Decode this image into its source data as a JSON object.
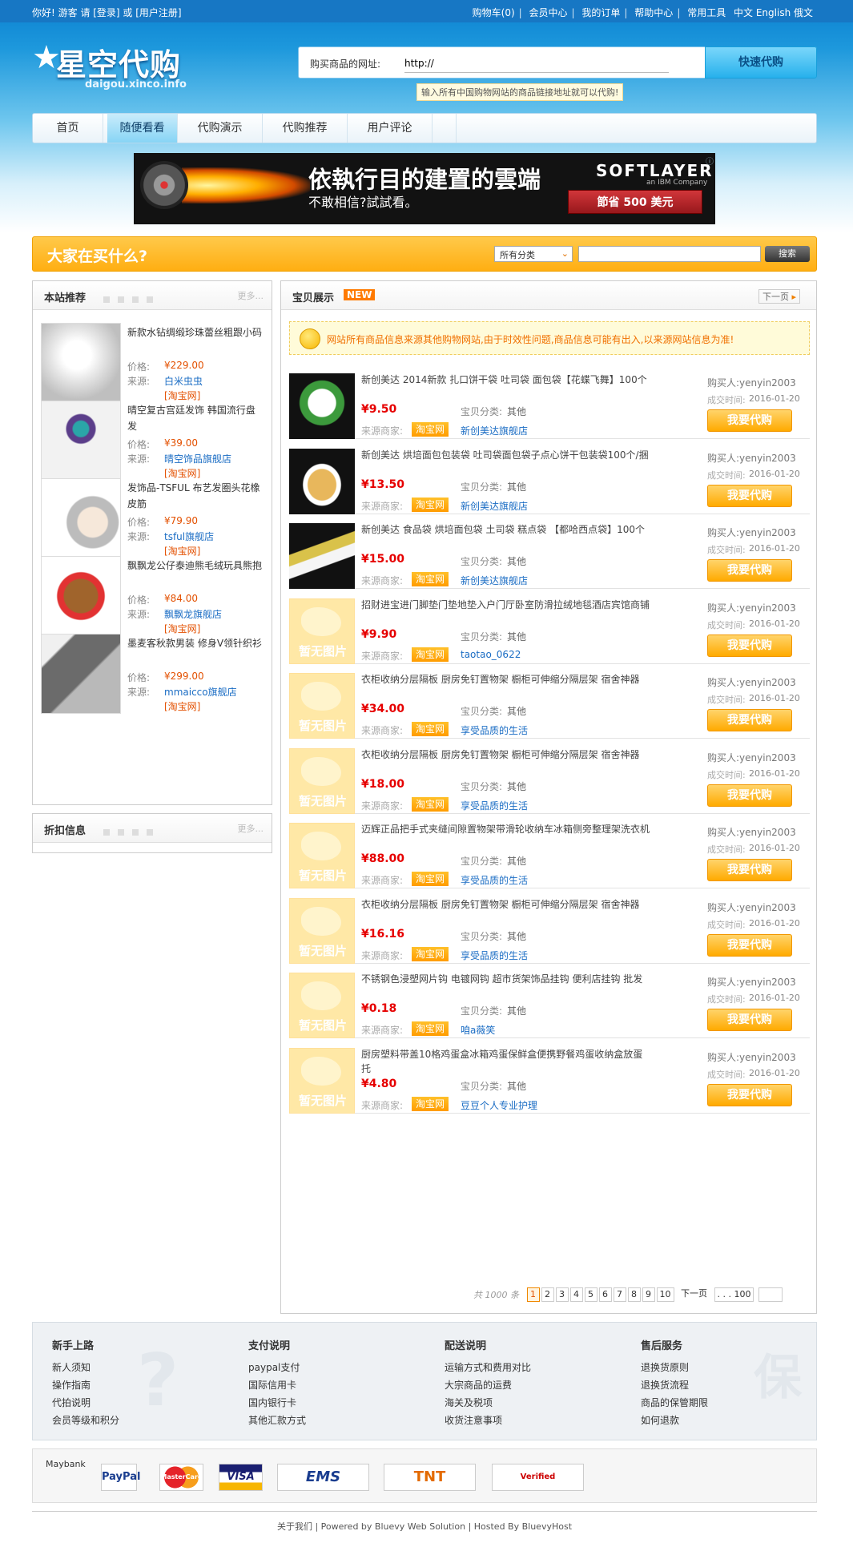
{
  "topbar": {
    "greeting": "你好! 游客 请 [登录] 或 [用户注册]",
    "links": [
      "购物车(0)",
      "会员中心",
      "我的订单",
      "帮助中心",
      "常用工具"
    ],
    "langs": "中文 English 俄文"
  },
  "logo": {
    "name": "星空代购",
    "url": "daigou.xinco.info"
  },
  "search": {
    "label": "购买商品的网址:",
    "value": "http://",
    "button": "快速代购",
    "hint": "输入所有中国购物网站的商品链接地址就可以代购!"
  },
  "nav": [
    "首页",
    "随便看看",
    "代购演示",
    "代购推荐",
    "用户评论"
  ],
  "ad": {
    "headline": "依執行目的建置的雲端",
    "sub": "不敢相信?試試看。",
    "brand": "SOFTLAYER",
    "brand_sub": "an IBM Company",
    "save": "節省 500 美元"
  },
  "what": {
    "title": "大家在买什么?",
    "category": "所有分类",
    "search_btn": "搜索"
  },
  "side": {
    "title": "本站推荐",
    "more": "更多",
    "price_label": "价格:",
    "source_label": "来源:",
    "items": [
      {
        "name": "新款水钻绸缎珍珠蕾丝粗跟小码",
        "price": "¥229.00",
        "shop": "白米虫虫",
        "tag": "[淘宝网]"
      },
      {
        "name": "晴空复古宫廷发饰 韩国流行盘发",
        "price": "¥39.00",
        "shop": "晴空饰品旗舰店",
        "tag": "[淘宝网]"
      },
      {
        "name": "发饰品-TSFUL 布艺发圈头花橡皮筋",
        "price": "¥79.90",
        "shop": "tsful旗舰店",
        "tag": "[淘宝网]"
      },
      {
        "name": "飘飘龙公仔泰迪熊毛绒玩具熊抱",
        "price": "¥84.00",
        "shop": "飘飘龙旗舰店",
        "tag": "[淘宝网]"
      },
      {
        "name": "墨麦客秋款男装 修身V领针织衫",
        "price": "¥299.00",
        "shop": "mmaicco旗舰店",
        "tag": "[淘宝网]"
      }
    ]
  },
  "discount": {
    "title": "折扣信息",
    "more": "更多"
  },
  "main": {
    "title": "宝贝展示",
    "new": "NEW",
    "next": "下一页",
    "notice": "网站所有商品信息来源其他购物网站,由于时效性问题,商品信息可能有出入,以来源网站信息为准!",
    "sales_label": "宝贝分类:",
    "sales_value": "其他",
    "source_label": "来源商家:",
    "buyer": "购买人:yenyin2003",
    "deal_label": "成交时间:",
    "deal_date": "2016-01-20",
    "buy_btn": "我要代购",
    "placeholder": "暂无图片",
    "items": [
      {
        "title": "新创美达 2014新款 扎口饼干袋 吐司袋 面包袋【花蝶飞舞】100个",
        "price": "¥9.50",
        "tag": "淘宝网",
        "shop": "新创美达旗舰店",
        "img": "real1"
      },
      {
        "title": "新创美达 烘培面包包装袋 吐司袋面包袋子点心饼干包装袋100个/捆",
        "price": "¥13.50",
        "tag": "淘宝网",
        "shop": "新创美达旗舰店",
        "img": "real2"
      },
      {
        "title": "新创美达 食品袋 烘培面包袋 土司袋 糕点袋 【都哈西点袋】100个",
        "price": "¥15.00",
        "tag": "淘宝网",
        "shop": "新创美达旗舰店",
        "img": "real3"
      },
      {
        "title": "招财进宝进门脚垫门垫地垫入户门厅卧室防滑拉绒地毯酒店宾馆商铺",
        "price": "¥9.90",
        "tag": "淘宝网",
        "shop": "taotao_0622",
        "img": "ph"
      },
      {
        "title": "衣柜收纳分层隔板 厨房免钉置物架 橱柜可伸缩分隔层架 宿舍神器",
        "price": "¥34.00",
        "tag": "淘宝网",
        "shop": "享受品质的生活",
        "img": "ph"
      },
      {
        "title": "衣柜收纳分层隔板 厨房免钉置物架 橱柜可伸缩分隔层架 宿舍神器",
        "price": "¥18.00",
        "tag": "淘宝网",
        "shop": "享受品质的生活",
        "img": "ph"
      },
      {
        "title": "迈辉正品把手式夹缝间隙置物架带滑轮收纳车冰箱侧旁整理架洗衣机",
        "price": "¥88.00",
        "tag": "淘宝网",
        "shop": "享受品质的生活",
        "img": "ph"
      },
      {
        "title": "衣柜收纳分层隔板 厨房免钉置物架 橱柜可伸缩分隔层架 宿舍神器",
        "price": "¥16.16",
        "tag": "淘宝网",
        "shop": "享受品质的生活",
        "img": "ph"
      },
      {
        "title": "不锈钢色浸塑网片钩 电镀网钩 超市货架饰品挂钩 便利店挂钩 批发",
        "price": "¥0.18",
        "tag": "淘宝网",
        "shop": "咱a薇笑",
        "img": "ph"
      },
      {
        "title": "厨房塑料带盖10格鸡蛋盒冰箱鸡蛋保鲜盒便携野餐鸡蛋收纳盒放蛋托",
        "price": "¥4.80",
        "tag": "淘宝网",
        "shop": "豆豆个人专业护理",
        "img": "ph"
      }
    ],
    "pager": {
      "total": "共 1000 条",
      "pages": [
        "1",
        "2",
        "3",
        "4",
        "5",
        "6",
        "7",
        "8",
        "9",
        "10"
      ],
      "next": "下一页",
      "dots": ". . . 100"
    }
  },
  "footer": {
    "cols": [
      {
        "h": "新手上路",
        "l": [
          "新人须知",
          "操作指南",
          "代拍说明",
          "会员等级和积分"
        ]
      },
      {
        "h": "支付说明",
        "l": [
          "paypal支付",
          "国际信用卡",
          "国内银行卡",
          "其他汇款方式"
        ]
      },
      {
        "h": "配送说明",
        "l": [
          "运输方式和费用对比",
          "大宗商品的运费",
          "海关及税项",
          "收货注意事项"
        ]
      },
      {
        "h": "售后服务",
        "l": [
          "退换货原则",
          "退换货流程",
          "商品的保管期限",
          "如何退款"
        ]
      }
    ],
    "bank": "Maybank",
    "pays": [
      "PayPal",
      "MasterCard",
      "VISA",
      "EMS",
      "TNT",
      "Verified"
    ],
    "bottom": "关于我们 | Powered by Bluevy Web Solution | Hosted By BluevyHost"
  }
}
